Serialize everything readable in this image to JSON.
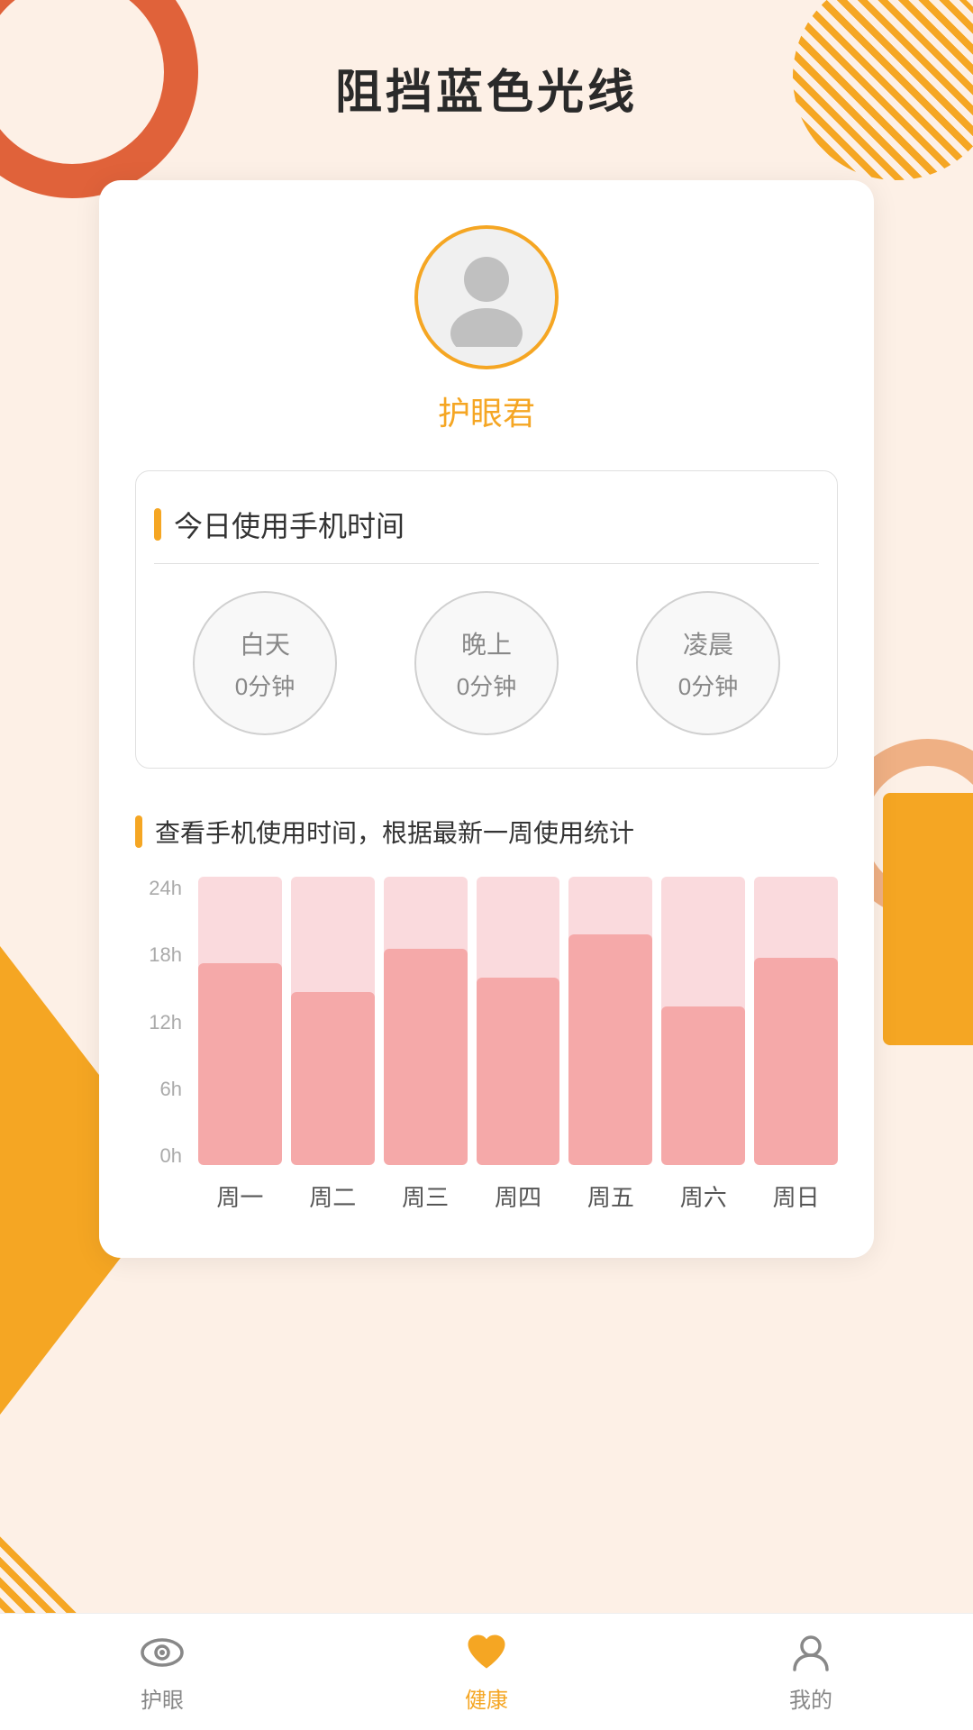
{
  "page": {
    "title": "阻挡蓝色光线",
    "background_color": "#fdf0e6"
  },
  "profile": {
    "username": "护眼君",
    "avatar_alt": "user avatar"
  },
  "today_usage": {
    "section_title": "今日使用手机时间",
    "periods": [
      {
        "label": "白天",
        "value": "0分钟"
      },
      {
        "label": "晚上",
        "value": "0分钟"
      },
      {
        "label": "凌晨",
        "value": "0分钟"
      }
    ]
  },
  "weekly_chart": {
    "section_title": "查看手机使用时间，根据最新一周使用统计",
    "y_labels": [
      "24h",
      "18h",
      "12h",
      "6h",
      "0h"
    ],
    "x_labels": [
      "周一",
      "周二",
      "周三",
      "周四",
      "周五",
      "周六",
      "周日"
    ],
    "bars": [
      {
        "day": "周一",
        "height_percent": 70
      },
      {
        "day": "周二",
        "height_percent": 60
      },
      {
        "day": "周三",
        "height_percent": 75
      },
      {
        "day": "周四",
        "height_percent": 65
      },
      {
        "day": "周五",
        "height_percent": 80
      },
      {
        "day": "周六",
        "height_percent": 55
      },
      {
        "day": "周日",
        "height_percent": 72
      }
    ]
  },
  "bottom_nav": {
    "items": [
      {
        "id": "eye",
        "label": "护眼",
        "active": false,
        "icon": "eye"
      },
      {
        "id": "health",
        "label": "健康",
        "active": true,
        "icon": "heart"
      },
      {
        "id": "mine",
        "label": "我的",
        "active": false,
        "icon": "person"
      }
    ]
  }
}
